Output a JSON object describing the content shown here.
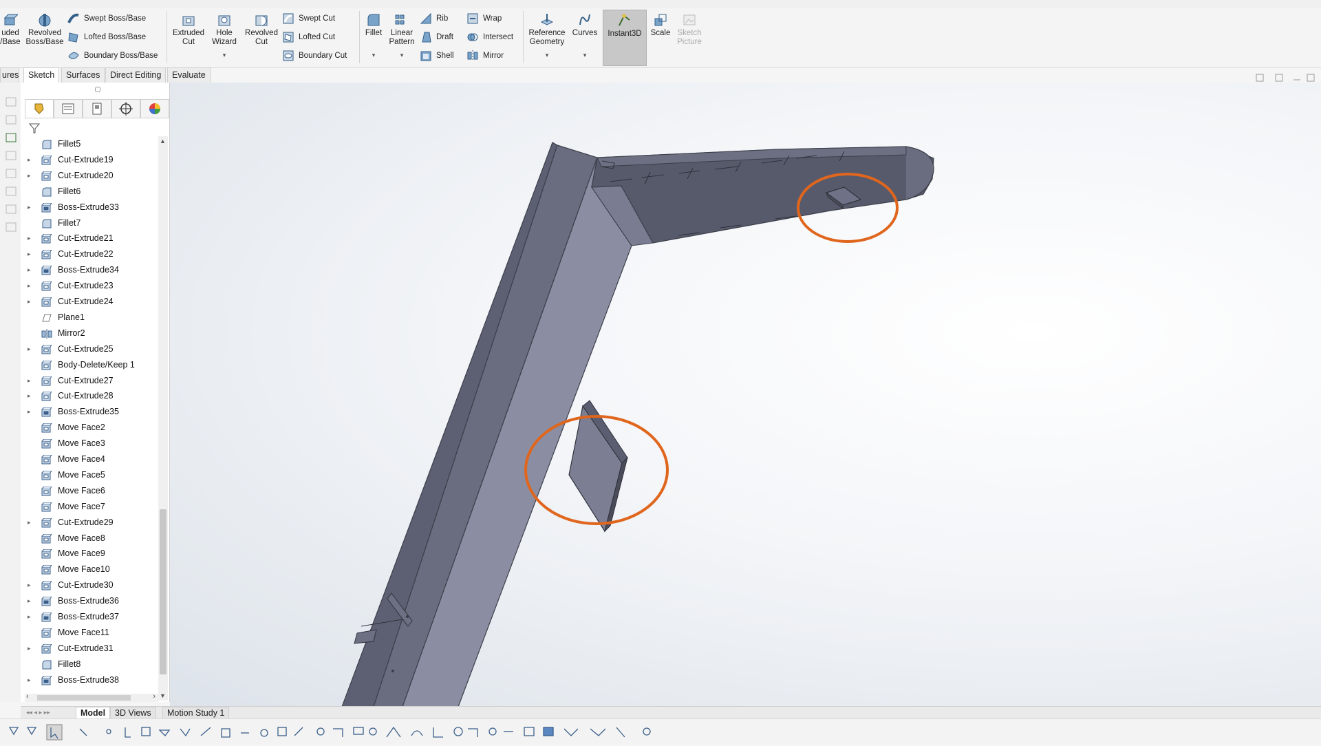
{
  "ribbon": {
    "col1": [
      "uded",
      "/Base"
    ],
    "revolved_boss": [
      "Revolved",
      "Boss/Base"
    ],
    "swept_boss": "Swept Boss/Base",
    "lofted_boss": "Lofted Boss/Base",
    "boundary_boss": "Boundary Boss/Base",
    "extruded_cut": [
      "Extruded",
      "Cut"
    ],
    "hole_wizard": [
      "Hole",
      "Wizard"
    ],
    "revolved_cut": [
      "Revolved",
      "Cut"
    ],
    "swept_cut": "Swept Cut",
    "lofted_cut": "Lofted Cut",
    "boundary_cut": "Boundary Cut",
    "fillet": "Fillet",
    "linear_pattern": [
      "Linear",
      "Pattern"
    ],
    "rib": "Rib",
    "draft": "Draft",
    "shell": "Shell",
    "wrap": "Wrap",
    "intersect": "Intersect",
    "mirror": "Mirror",
    "reference_geometry": [
      "Reference",
      "Geometry"
    ],
    "curves": "Curves",
    "instant3d": "Instant3D",
    "scale": "Scale",
    "sketch_picture": [
      "Sketch",
      "Picture"
    ]
  },
  "tabs": [
    "ures",
    "Sketch",
    "Surfaces",
    "Direct Editing",
    "Evaluate"
  ],
  "tree": [
    {
      "label": "Fillet5",
      "expandable": false,
      "kind": "fillet"
    },
    {
      "label": "Cut-Extrude19",
      "expandable": true,
      "kind": "cut"
    },
    {
      "label": "Cut-Extrude20",
      "expandable": true,
      "kind": "cut"
    },
    {
      "label": "Fillet6",
      "expandable": false,
      "kind": "fillet"
    },
    {
      "label": "Boss-Extrude33",
      "expandable": true,
      "kind": "boss"
    },
    {
      "label": "Fillet7",
      "expandable": false,
      "kind": "fillet"
    },
    {
      "label": "Cut-Extrude21",
      "expandable": true,
      "kind": "cut"
    },
    {
      "label": "Cut-Extrude22",
      "expandable": true,
      "kind": "cut"
    },
    {
      "label": "Boss-Extrude34",
      "expandable": true,
      "kind": "boss"
    },
    {
      "label": "Cut-Extrude23",
      "expandable": true,
      "kind": "cut"
    },
    {
      "label": "Cut-Extrude24",
      "expandable": true,
      "kind": "cut"
    },
    {
      "label": "Plane1",
      "expandable": false,
      "kind": "plane"
    },
    {
      "label": "Mirror2",
      "expandable": false,
      "kind": "mirror"
    },
    {
      "label": "Cut-Extrude25",
      "expandable": true,
      "kind": "cut"
    },
    {
      "label": "Body-Delete/Keep 1",
      "expandable": false,
      "kind": "body"
    },
    {
      "label": "Cut-Extrude27",
      "expandable": true,
      "kind": "cut"
    },
    {
      "label": "Cut-Extrude28",
      "expandable": true,
      "kind": "cut"
    },
    {
      "label": "Boss-Extrude35",
      "expandable": true,
      "kind": "boss"
    },
    {
      "label": "Move Face2",
      "expandable": false,
      "kind": "move"
    },
    {
      "label": "Move Face3",
      "expandable": false,
      "kind": "move"
    },
    {
      "label": "Move Face4",
      "expandable": false,
      "kind": "move"
    },
    {
      "label": "Move Face5",
      "expandable": false,
      "kind": "move"
    },
    {
      "label": "Move Face6",
      "expandable": false,
      "kind": "move"
    },
    {
      "label": "Move Face7",
      "expandable": false,
      "kind": "move"
    },
    {
      "label": "Cut-Extrude29",
      "expandable": true,
      "kind": "cut"
    },
    {
      "label": "Move Face8",
      "expandable": false,
      "kind": "move"
    },
    {
      "label": "Move Face9",
      "expandable": false,
      "kind": "move"
    },
    {
      "label": "Move Face10",
      "expandable": false,
      "kind": "move"
    },
    {
      "label": "Cut-Extrude30",
      "expandable": true,
      "kind": "cut"
    },
    {
      "label": "Boss-Extrude36",
      "expandable": true,
      "kind": "boss"
    },
    {
      "label": "Boss-Extrude37",
      "expandable": true,
      "kind": "boss"
    },
    {
      "label": "Move Face11",
      "expandable": false,
      "kind": "move"
    },
    {
      "label": "Cut-Extrude31",
      "expandable": true,
      "kind": "cut"
    },
    {
      "label": "Fillet8",
      "expandable": false,
      "kind": "fillet"
    },
    {
      "label": "Boss-Extrude38",
      "expandable": true,
      "kind": "boss"
    }
  ],
  "bottom_tabs": [
    "Model",
    "3D Views",
    "Motion Study 1"
  ],
  "colors": {
    "highlight": "#e0661d",
    "part": "#6e7184",
    "instant3d_bg": "#c8c8c8"
  }
}
